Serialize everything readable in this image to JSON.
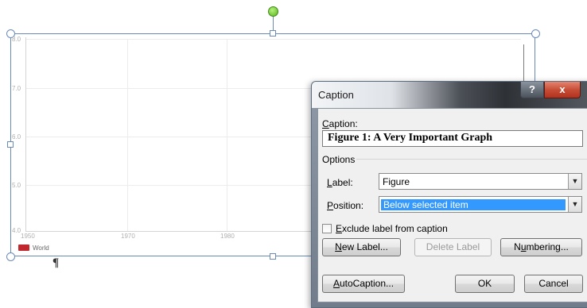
{
  "chart": {
    "y_ticks": [
      "8.0",
      "7.0",
      "6.0",
      "5.0",
      "4.0"
    ],
    "x_ticks": [
      "1950",
      "1970",
      "1980"
    ],
    "legend_label": "World",
    "legend_color": "#c0282e",
    "pilcrow": "¶"
  },
  "dialog": {
    "title": "Caption",
    "help_label": "?",
    "close_label": "x",
    "caption_label_key": "C",
    "caption_label_rest": "aption:",
    "caption_value": "Figure 1: A Very Important Graph",
    "options_label": "Options",
    "label_key": "L",
    "label_rest": "abel:",
    "label_value": "Figure",
    "position_key": "P",
    "position_rest": "osition:",
    "position_value": "Below selected item",
    "exclude_key": "E",
    "exclude_rest": "xclude label from caption",
    "exclude_checked": false,
    "new_label_key": "N",
    "new_label_rest": "ew Label...",
    "delete_label": "Delete Label",
    "numbering_pre": "N",
    "numbering_key": "u",
    "numbering_rest": "mbering...",
    "autocaption_key": "A",
    "autocaption_rest": "utoCaption...",
    "ok_label": "OK",
    "cancel_label": "Cancel"
  }
}
